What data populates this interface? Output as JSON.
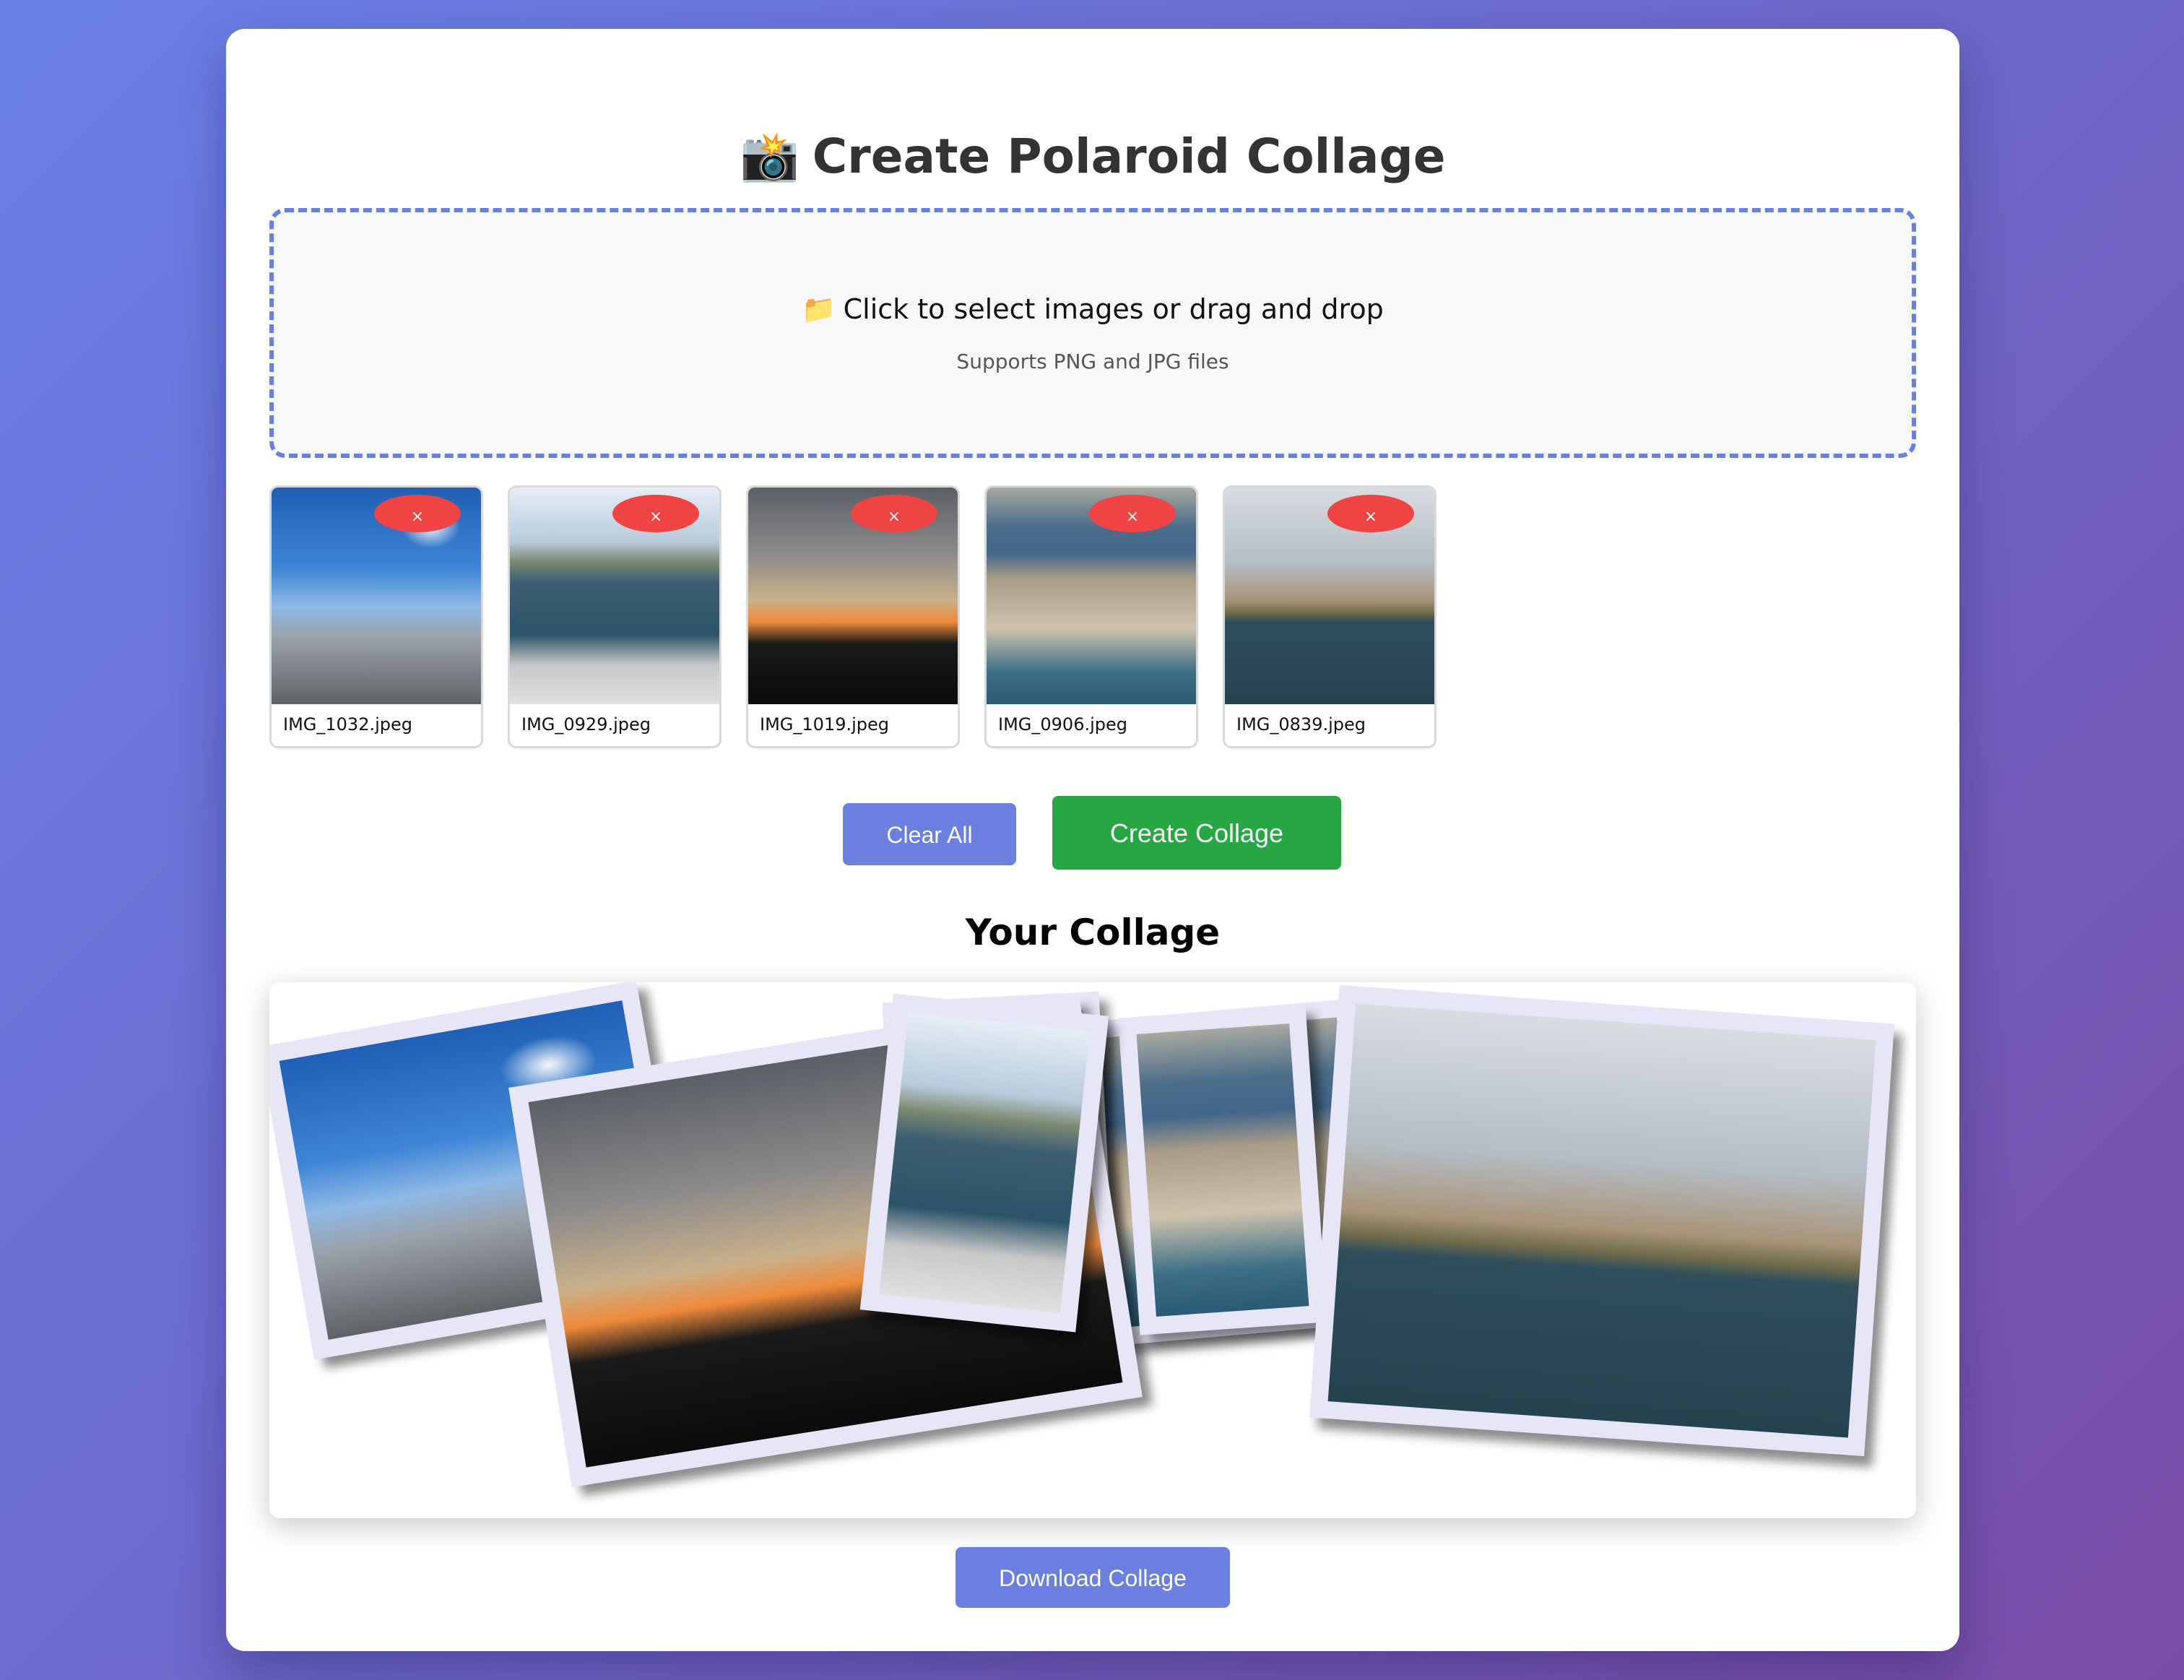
{
  "header": {
    "icon": "camera-flash-icon",
    "title": "Create Polaroid Collage"
  },
  "dropzone": {
    "icon": "folder-icon",
    "text": "Click to select images or drag and drop",
    "subtext": "Supports PNG and JPG files"
  },
  "thumbnails": [
    {
      "filename": "IMG_1032.jpeg",
      "remove_label": "×"
    },
    {
      "filename": "IMG_0929.jpeg",
      "remove_label": "×"
    },
    {
      "filename": "IMG_1019.jpeg",
      "remove_label": "×"
    },
    {
      "filename": "IMG_0906.jpeg",
      "remove_label": "×"
    },
    {
      "filename": "IMG_0839.jpeg",
      "remove_label": "×"
    }
  ],
  "actions": {
    "clear_label": "Clear All",
    "create_label": "Create Collage"
  },
  "collage": {
    "title": "Your Collage",
    "download_label": "Download Collage"
  },
  "colors": {
    "accent": "#6a7fe0",
    "create_button": "#27a744",
    "remove_button": "#f04444",
    "polaroid_frame": "#e6e6f6"
  }
}
